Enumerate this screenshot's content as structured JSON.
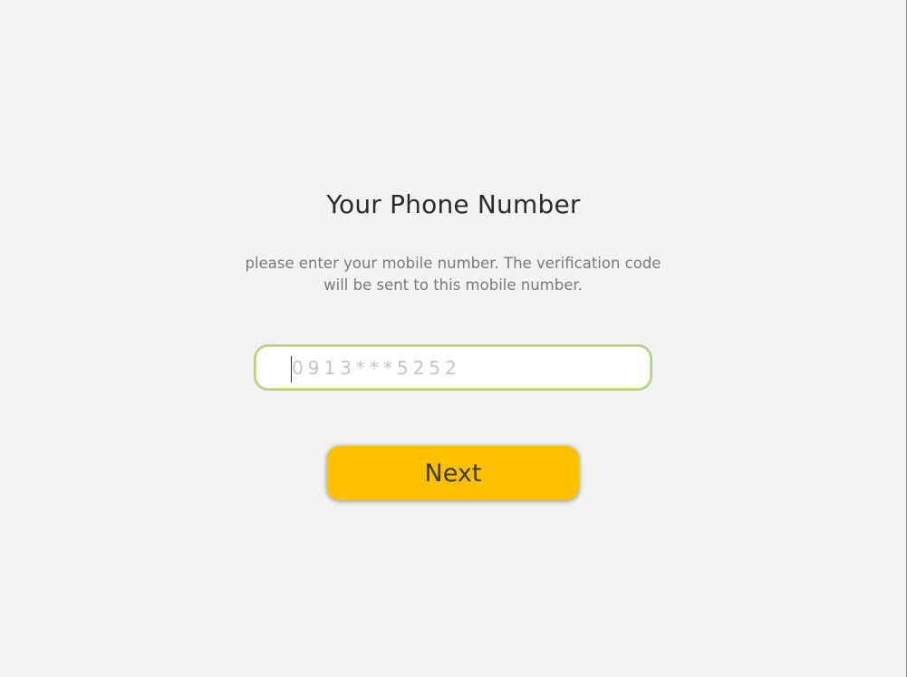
{
  "header": {
    "title": "Your Phone Number",
    "subtitle": "please enter your mobile number. The verification code will be sent to this mobile number."
  },
  "phone": {
    "value": "",
    "placeholder": "0913***5252"
  },
  "actions": {
    "next_label": "Next"
  },
  "colors": {
    "background": "#f3f3f3",
    "button": "#ffc000",
    "input_border": "#a9d08e"
  }
}
